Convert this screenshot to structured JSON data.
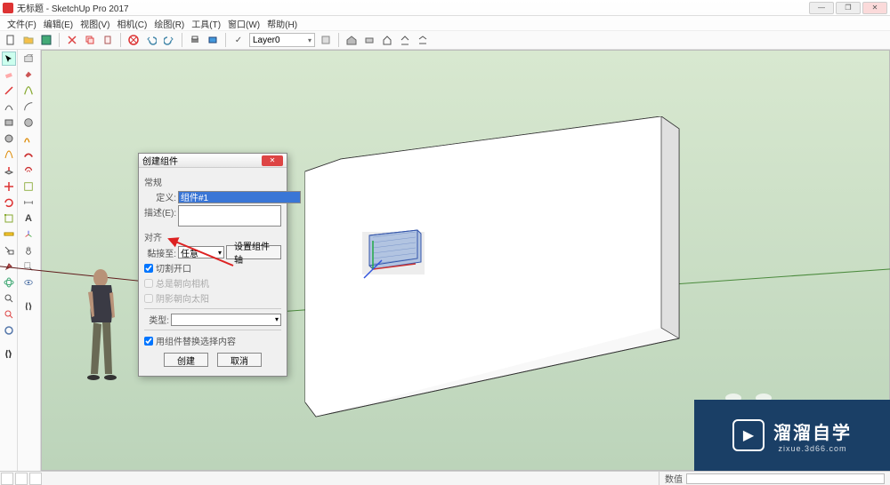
{
  "titlebar": {
    "title": "无标题 - SketchUp Pro 2017"
  },
  "menubar": {
    "items": [
      "文件(F)",
      "编辑(E)",
      "视图(V)",
      "相机(C)",
      "绘图(R)",
      "工具(T)",
      "窗口(W)",
      "帮助(H)"
    ]
  },
  "toolbar": {
    "layer_label": "Layer0"
  },
  "dialog": {
    "title": "创建组件",
    "section_general": "常规",
    "def_label": "定义:",
    "def_value": "组件#1",
    "desc_label": "描述(E):",
    "section_align": "对齐",
    "glue_label": "黏接至:",
    "glue_value": "任意",
    "set_axes_btn": "设置组件轴",
    "cut_opening": "切割开口",
    "face_camera": "总是朝向相机",
    "shadows_face_sun": "阴影朝向太阳",
    "type_label": "类型:",
    "replace_sel": "用组件替换选择内容",
    "create_btn": "创建",
    "cancel_btn": "取消"
  },
  "statusbar": {
    "measure_label": "数值"
  },
  "watermark": {
    "cn": "溜溜自学",
    "en": "zixue.3d66.com"
  }
}
